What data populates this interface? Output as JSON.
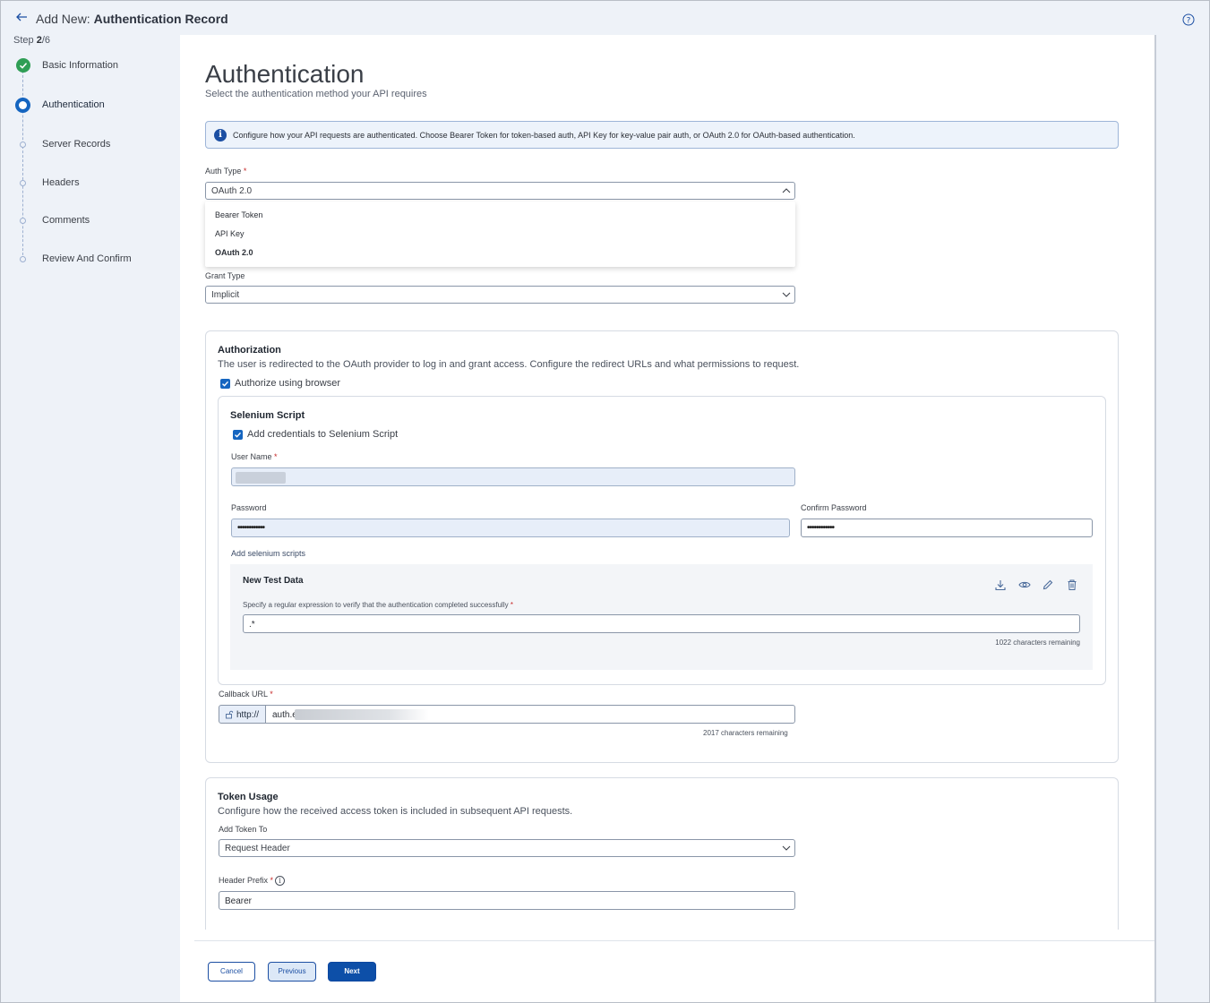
{
  "header": {
    "title_prefix": "Add New:",
    "title_bold": "Authentication Record"
  },
  "stepper": {
    "step_label": "Step",
    "current": "2",
    "total": "/6",
    "steps": [
      {
        "label": "Basic Information",
        "state": "done"
      },
      {
        "label": "Authentication",
        "state": "current"
      },
      {
        "label": "Server Records",
        "state": "pending"
      },
      {
        "label": "Headers",
        "state": "pending"
      },
      {
        "label": "Comments",
        "state": "pending"
      },
      {
        "label": "Review And Confirm",
        "state": "pending"
      }
    ]
  },
  "page": {
    "title": "Authentication",
    "subtitle": "Select the authentication method your API requires",
    "info": "Configure how your API requests are authenticated. Choose Bearer Token for token-based auth, API Key for key-value pair auth, or OAuth 2.0 for OAuth-based authentication."
  },
  "auth_type": {
    "label": "Auth Type",
    "value": "OAuth 2.0",
    "options": [
      "Bearer Token",
      "API Key",
      "OAuth 2.0"
    ]
  },
  "grant_type": {
    "label": "Grant Type",
    "value": "Implicit"
  },
  "authorization": {
    "title": "Authorization",
    "description": "The user is redirected to the OAuth provider to log in and grant access. Configure the redirect URLs and what permissions to request.",
    "checkbox_label": "Authorize using browser",
    "checked": true,
    "selenium": {
      "title": "Selenium Script",
      "checkbox_label": "Add credentials to Selenium Script",
      "checked": true,
      "username_label": "User Name",
      "password_label": "Password",
      "password_value": "••••••••••••",
      "confirm_label": "Confirm Password",
      "confirm_value": "••••••••••••",
      "scripts_link": "Add selenium scripts",
      "test_data": {
        "title": "New Test Data",
        "regex_label": "Specify a regular expression to verify that the authentication completed successfully",
        "regex_value": ".*",
        "remaining": "1022 characters remaining"
      }
    },
    "callback": {
      "label": "Callback URL",
      "prefix": "http://",
      "value": "auth.e",
      "remaining": "2017 characters remaining"
    }
  },
  "token_usage": {
    "title": "Token Usage",
    "description": "Configure how the received access token is included in subsequent API requests.",
    "add_token_label": "Add Token To",
    "add_token_value": "Request Header",
    "prefix_label": "Header Prefix",
    "prefix_value": "Bearer"
  },
  "footer": {
    "cancel": "Cancel",
    "previous": "Previous",
    "next": "Next"
  },
  "colors": {
    "primary": "#0d4fa8",
    "success": "#2f9e55",
    "required": "#c62828"
  }
}
